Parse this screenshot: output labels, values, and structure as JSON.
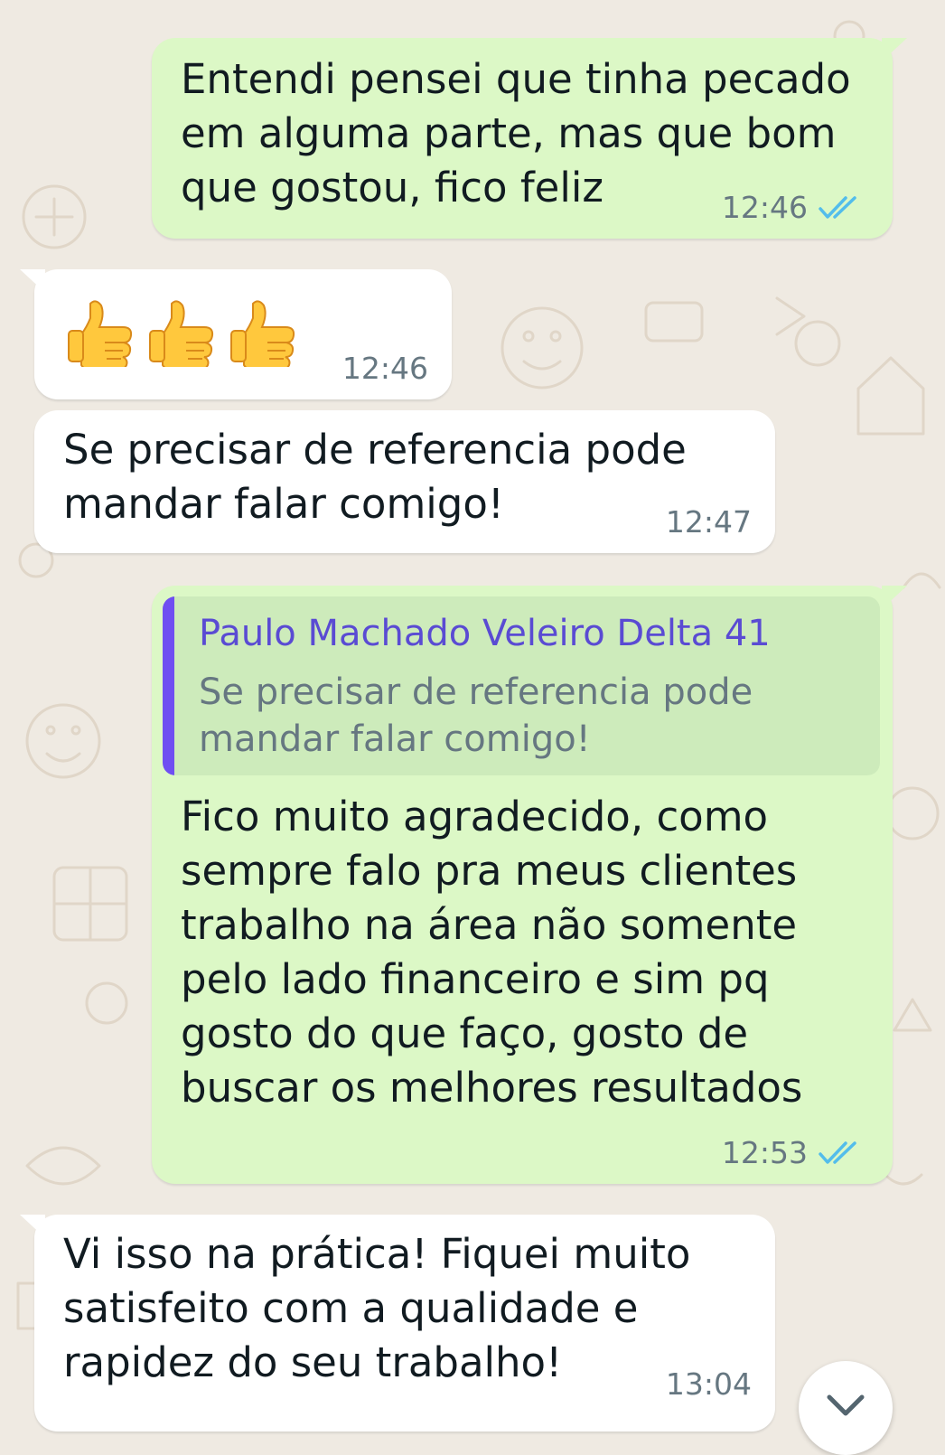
{
  "colors": {
    "outgoing_bubble": "#dcf8c6",
    "incoming_bubble": "#ffffff",
    "wallpaper": "#efeae2",
    "read_ticks": "#53bdeb",
    "quote_accent": "#6f4ff2",
    "quote_author": "#5a4bd3",
    "timestamp": "#667781"
  },
  "messages": [
    {
      "direction": "outgoing",
      "text": "Entendi pensei que tinha pecado\nem alguma parte, mas que bom\nque gostou, fico feliz",
      "time": "12:46",
      "status_icon": "double-check-read-icon"
    },
    {
      "direction": "incoming",
      "emoji": [
        "👍",
        "👍",
        "👍"
      ],
      "emoji_icon": "thumbs-up-icon",
      "time": "12:46"
    },
    {
      "direction": "incoming",
      "text": "Se precisar de referencia pode\nmandar falar comigo!",
      "time": "12:47"
    },
    {
      "direction": "outgoing",
      "quote": {
        "author": "Paulo Machado Veleiro Delta 41",
        "text": "Se precisar de referencia pode\nmandar falar comigo!"
      },
      "text": "Fico muito agradecido,  como\nsempre falo pra meus clientes\ntrabalho na área não somente\npelo lado financeiro e sim pq\ngosto do que faço,  gosto de\nbuscar os melhores resultados",
      "time": "12:53",
      "status_icon": "double-check-read-icon"
    },
    {
      "direction": "incoming",
      "text": "Vi isso na prática! Fiquei muito\nsatisfeito com a qualidade e\nrapidez do seu trabalho!",
      "time": "13:04"
    }
  ],
  "scroll_button": {
    "icon": "chevron-down-icon"
  }
}
